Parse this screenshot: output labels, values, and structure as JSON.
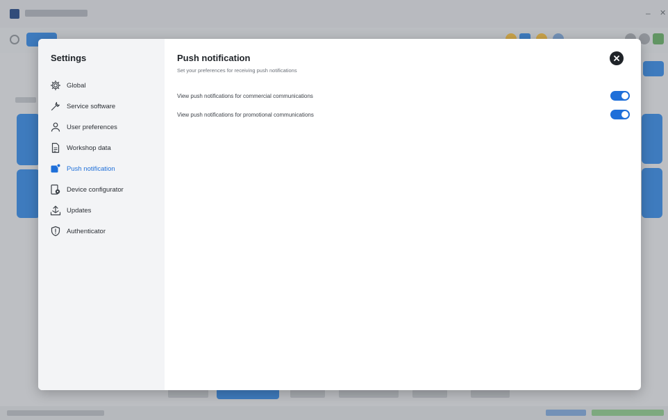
{
  "settings": {
    "title": "Settings",
    "nav": [
      {
        "label": "Global",
        "icon": "gear-icon"
      },
      {
        "label": "Service software",
        "icon": "wrench-icon"
      },
      {
        "label": "User preferences",
        "icon": "user-icon"
      },
      {
        "label": "Workshop data",
        "icon": "document-icon"
      },
      {
        "label": "Push notification",
        "icon": "notification-icon",
        "active": true
      },
      {
        "label": "Device configurator",
        "icon": "device-config-icon"
      },
      {
        "label": "Updates",
        "icon": "updates-icon"
      },
      {
        "label": "Authenticator",
        "icon": "shield-icon"
      }
    ]
  },
  "panel": {
    "title": "Push notification",
    "subtitle": "Set your preferences for receiving push notifications",
    "options": [
      {
        "label": "View push notifications for commercial communications",
        "enabled": true
      },
      {
        "label": "View push notifications for promotional communications",
        "enabled": true
      }
    ]
  },
  "colors": {
    "accent": "#1e6fd9",
    "sidebar_bg": "#f3f4f6",
    "modal_bg": "#ffffff",
    "close_button": "#1f2328"
  }
}
